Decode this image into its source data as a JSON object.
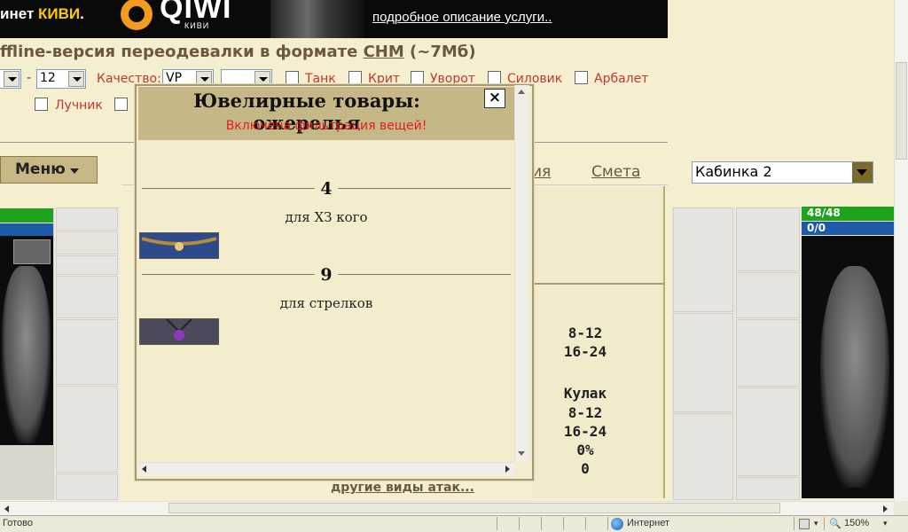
{
  "banner": {
    "left_text": "инет",
    "left_brand": "КИВИ",
    "left_dot": ".",
    "qiwi_word": "QIWI",
    "qiwi_sub": "КИВИ",
    "link": "подробное описание услуги.."
  },
  "header": {
    "offline_prefix": "ffline-версия переодевалки в формате",
    "chm": "CHM",
    "size": "(~7Мб)"
  },
  "filters": {
    "level_to": "12",
    "dash": "-",
    "quality_label": "Качество:",
    "quality_value": "VP",
    "second_select": "",
    "checkbox_labels": [
      "Танк",
      "Крит",
      "Уворот",
      "Силовик",
      "Арбалет",
      "Лучник"
    ]
  },
  "nav": {
    "menu_label": "Меню",
    "tab_partial": "ия",
    "tab_smeta": "Смета",
    "cabinet_value": "Кабинка 2"
  },
  "character": {
    "hp": "48/48",
    "mp": "0/0"
  },
  "stats": {
    "dmg1": "8-12",
    "dmg2": "16-24",
    "weapon": "Кулак",
    "dmg3": "8-12",
    "dmg4": "16-24",
    "pct": "0%",
    "zero": "0",
    "other_attacks": "другие виды атак..."
  },
  "popup": {
    "title": "Ювелирные товары: ожерелья",
    "filter_notice": "Включена фильтрация вещей!",
    "close": "×",
    "groups": [
      {
        "number": "4",
        "label": "для ХЗ кого"
      },
      {
        "number": "9",
        "label": "для стрелков"
      }
    ]
  },
  "statusbar": {
    "status": "Готово",
    "zone": "Интернет",
    "zoom": "150%"
  },
  "colors": {
    "accent_red": "#e02020",
    "hp_green": "#1fa31f",
    "mp_blue": "#1f5aa8",
    "header_tan": "#c6b886"
  }
}
